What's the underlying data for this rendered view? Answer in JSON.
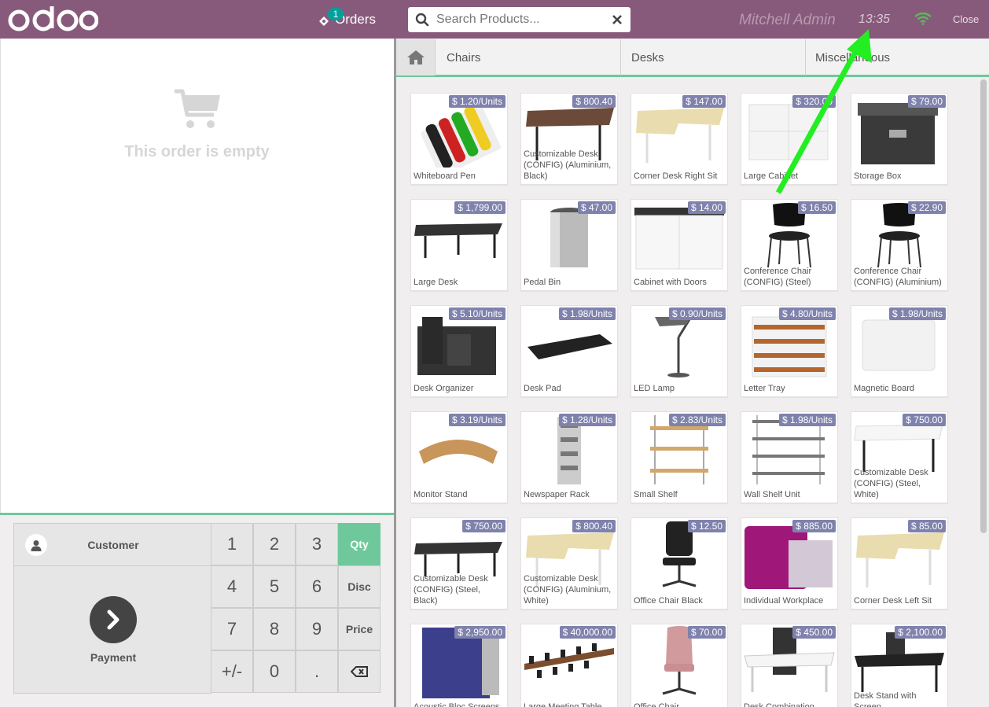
{
  "header": {
    "orders_label": "Orders",
    "orders_count": "1",
    "search_placeholder": "Search Products...",
    "user": "Mitchell Admin",
    "time": "13:35",
    "close_label": "Close"
  },
  "colors": {
    "header": "#875A7B",
    "accent": "#6EC89B",
    "price_tag": "#7F82AC",
    "badge": "#00A09D"
  },
  "order": {
    "empty_text": "This order is empty"
  },
  "actions": {
    "customer": "Customer",
    "payment": "Payment"
  },
  "numpad": {
    "keys": [
      "1",
      "2",
      "3",
      "4",
      "5",
      "6",
      "7",
      "8",
      "9",
      "+/-",
      "0",
      "."
    ],
    "modes": [
      "Qty",
      "Disc",
      "Price"
    ],
    "active_mode": "Qty"
  },
  "categories": [
    "Chairs",
    "Desks",
    "Miscellaneous"
  ],
  "products": [
    {
      "name": "Whiteboard Pen",
      "price": "$ 1.20/Units",
      "img": "pens"
    },
    {
      "name": "Customizable Desk (CONFIG) (Aluminium, Black)",
      "price": "$ 800.40",
      "img": "desk-brown"
    },
    {
      "name": "Corner Desk Right Sit",
      "price": "$ 147.00",
      "img": "desk-light"
    },
    {
      "name": "Large Cabinet",
      "price": "$ 320.00",
      "img": "cabinet"
    },
    {
      "name": "Storage Box",
      "price": "$ 79.00",
      "img": "box"
    },
    {
      "name": "Large Desk",
      "price": "$ 1,799.00",
      "img": "desk-dark"
    },
    {
      "name": "Pedal Bin",
      "price": "$ 47.00",
      "img": "bin"
    },
    {
      "name": "Cabinet with Doors",
      "price": "$ 14.00",
      "img": "cabinet-doors"
    },
    {
      "name": "Conference Chair (CONFIG) (Steel)",
      "price": "$ 16.50",
      "img": "chair"
    },
    {
      "name": "Conference Chair (CONFIG) (Aluminium)",
      "price": "$ 22.90",
      "img": "chair"
    },
    {
      "name": "Desk Organizer",
      "price": "$ 5.10/Units",
      "img": "organizer"
    },
    {
      "name": "Desk Pad",
      "price": "$ 1.98/Units",
      "img": "pad"
    },
    {
      "name": "LED Lamp",
      "price": "$ 0.90/Units",
      "img": "lamp"
    },
    {
      "name": "Letter Tray",
      "price": "$ 4.80/Units",
      "img": "tray"
    },
    {
      "name": "Magnetic Board",
      "price": "$ 1.98/Units",
      "img": "board"
    },
    {
      "name": "Monitor Stand",
      "price": "$ 3.19/Units",
      "img": "stand"
    },
    {
      "name": "Newspaper Rack",
      "price": "$ 1.28/Units",
      "img": "rack"
    },
    {
      "name": "Small Shelf",
      "price": "$ 2.83/Units",
      "img": "shelf"
    },
    {
      "name": "Wall Shelf Unit",
      "price": "$ 1.98/Units",
      "img": "wall-shelf"
    },
    {
      "name": "Customizable Desk (CONFIG) (Steel, White)",
      "price": "$ 750.00",
      "img": "desk-white"
    },
    {
      "name": "Customizable Desk (CONFIG) (Steel, Black)",
      "price": "$ 750.00",
      "img": "desk-dark"
    },
    {
      "name": "Customizable Desk (CONFIG) (Aluminium, White)",
      "price": "$ 800.40",
      "img": "desk-light"
    },
    {
      "name": "Office Chair Black",
      "price": "$ 12.50",
      "img": "office-chair"
    },
    {
      "name": "Individual Workplace",
      "price": "$ 885.00",
      "img": "workplace"
    },
    {
      "name": "Corner Desk Left Sit",
      "price": "$ 85.00",
      "img": "desk-light"
    },
    {
      "name": "Acoustic Bloc Screens",
      "price": "$ 2,950.00",
      "img": "screens"
    },
    {
      "name": "Large Meeting Table",
      "price": "$ 40,000.00",
      "img": "meeting-table"
    },
    {
      "name": "Office Chair",
      "price": "$ 70.00",
      "img": "pink-chair"
    },
    {
      "name": "Desk Combination",
      "price": "$ 450.00",
      "img": "desk-combo"
    },
    {
      "name": "Desk Stand with Screen",
      "price": "$ 2,100.00",
      "img": "desk-screen"
    }
  ]
}
